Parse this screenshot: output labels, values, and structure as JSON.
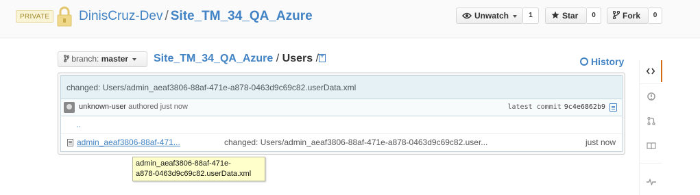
{
  "repo": {
    "privacy_label": "PRIVATE",
    "owner": "DinisCruz-Dev",
    "separator": "/",
    "name": "Site_TM_34_QA_Azure"
  },
  "actions": {
    "watch": {
      "label": "Unwatch",
      "count": "1"
    },
    "star": {
      "label": "Star",
      "count": "0"
    },
    "fork": {
      "label": "Fork",
      "count": "0"
    }
  },
  "nav": {
    "branch_prefix": "branch:",
    "branch": "master",
    "breadcrumb_root": "Site_TM_34_QA_Azure",
    "breadcrumb_sep": "/",
    "breadcrumb_current": "Users",
    "breadcrumb_trailing_sep": "/",
    "history_label": "History"
  },
  "commit": {
    "message": "changed: Users/admin_aeaf3806-88af-471e-a878-0463d9c69c82.userData.xml",
    "author": "unknown-user",
    "authored_text": "authored just now",
    "latest_label": "latest commit",
    "sha": "9c4e6862b9"
  },
  "files": {
    "parent_dir": "..",
    "rows": [
      {
        "name": "admin_aeaf3806-88af-471...",
        "message": "changed: Users/admin_aeaf3806-88af-471e-a878-0463d9c69c82.user...",
        "age": "just now"
      }
    ]
  },
  "tooltip": {
    "line1": "admin_aeaf3806-88af-471e-",
    "line2": "a878-0463d9c69c82.userData.xml"
  },
  "sidebar": {
    "items": [
      "code-icon",
      "issues-icon",
      "pull-requests-icon",
      "wiki-icon",
      "pulse-icon"
    ],
    "accent_color": "#d26911"
  },
  "colors": {
    "link": "#4183c4",
    "commit_bg": "#e6f1f6",
    "tooltip_bg": "#ffffcc"
  }
}
